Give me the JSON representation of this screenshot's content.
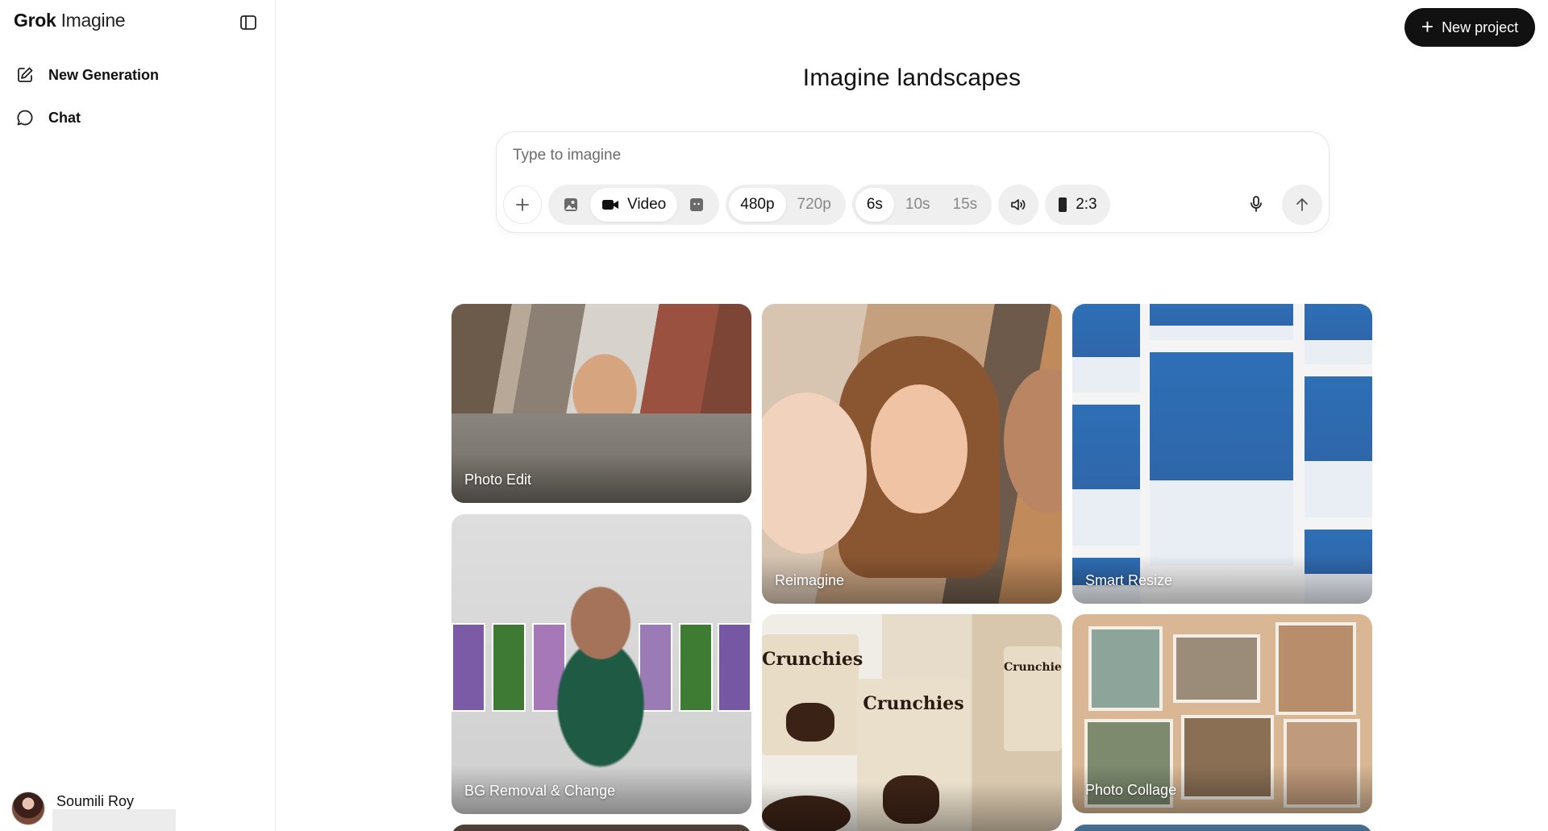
{
  "app": {
    "brand_bold": "Grok",
    "brand_light": "Imagine"
  },
  "sidebar": {
    "items": [
      {
        "label": "New Generation",
        "icon": "edit-icon"
      },
      {
        "label": "Chat",
        "icon": "chat-bubble-icon"
      }
    ],
    "user": {
      "name": "Soumili Roy"
    }
  },
  "header": {
    "new_project_label": "New project",
    "title": "Imagine landscapes"
  },
  "composer": {
    "placeholder": "Type to imagine",
    "mode": {
      "video_label": "Video",
      "selected": "Video"
    },
    "resolution": {
      "options": [
        "480p",
        "720p"
      ],
      "selected": "480p"
    },
    "duration": {
      "options": [
        "6s",
        "10s",
        "15s"
      ],
      "selected": "6s"
    },
    "aspect_ratio": "2:3"
  },
  "gallery": {
    "cards": [
      {
        "label": "Photo Edit"
      },
      {
        "label": "Reimagine"
      },
      {
        "label": "Smart Resize"
      },
      {
        "label": "BG Removal & Change"
      },
      {
        "label": "Photo Collage"
      }
    ],
    "crunchies_brand": "Crunchies"
  },
  "colors": {
    "primary_button": "#111111",
    "segment_bg": "#efefef",
    "border": "#e6e6e6"
  }
}
